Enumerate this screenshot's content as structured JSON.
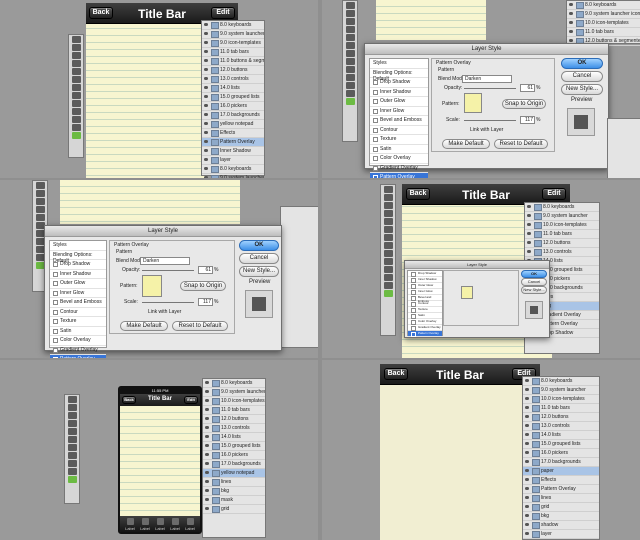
{
  "titlebar": {
    "back": "Back",
    "title": "Title Bar",
    "edit": "Edit"
  },
  "phone_status": {
    "time": "11:55 PM"
  },
  "phone_tabs": [
    "Label",
    "Label",
    "Label",
    "Label",
    "Label"
  ],
  "layers_a": [
    "8.0 keyboards",
    "9.0 system launcher icons",
    "9.0 icon-templates",
    "11.0 tab bars",
    "11.0 buttons & segmented controls",
    "12.0 buttons",
    "13.0 controls",
    "14.0 lists",
    "15.0 grouped lists",
    "16.0 pickers",
    "17.0 backgrounds",
    "yellow notepad",
    "Effects",
    "Pattern Overlay",
    "Inner Shadow",
    "layer",
    "8.0 keyboards",
    "9.0 system launcher icons",
    "10.0 icon-templates",
    "11.0 tab bars",
    "12.0 buttons & segmented c"
  ],
  "layers_b": [
    "8.0 keyboards",
    "9.0 system launcher icons",
    "10.0 icon-templates",
    "11.0 tab bars",
    "12.0 buttons & segmented c"
  ],
  "layers_d": [
    "8.0 keyboards",
    "9.0 system launcher",
    "10.0 icon-templates",
    "11.0 tab bars",
    "12.0 buttons",
    "13.0 controls",
    "14.0 lists",
    "15.0 grouped lists",
    "16.0 pickers",
    "17.0 backgrounds",
    "lines",
    "bkg",
    "Gradient Overlay",
    "Pattern Overlay",
    "Drop Shadow"
  ],
  "layers_e": [
    "8.0 keyboards",
    "9.0 system launcher icons",
    "10.0 icon-templates",
    "11.0 tab bars",
    "12.0 buttons",
    "13.0 controls",
    "14.0 lists",
    "15.0 grouped lists",
    "16.0 pickers",
    "17.0 backgrounds",
    "yellow notepad",
    "lines",
    "bkg",
    "mask",
    "grid"
  ],
  "layers_f": [
    "8.0 keyboards",
    "9.0 system launcher",
    "10.0 icon-templates",
    "11.0 tab bars",
    "12.0 buttons",
    "13.0 controls",
    "14.0 lists",
    "15.0 grouped lists",
    "16.0 pickers",
    "17.0 backgrounds",
    "paper",
    "Effects",
    "Pattern Overlay",
    "lines",
    "grid",
    "bkg",
    "shadow",
    "layer",
    "mask",
    "group"
  ],
  "layer_style": {
    "title": "Layer Style",
    "styles_header": "Styles",
    "blending": "Blending Options: Default",
    "items": [
      "Drop Shadow",
      "Inner Shadow",
      "Outer Glow",
      "Inner Glow",
      "Bevel and Emboss",
      "Contour",
      "Texture",
      "Satin",
      "Color Overlay",
      "Gradient Overlay",
      "Pattern Overlay"
    ],
    "group_title": "Pattern Overlay",
    "sub_title": "Pattern",
    "blend_label": "Blend Mode:",
    "blend_value": "Darken",
    "opacity_label": "Opacity:",
    "opacity_value": "61",
    "opacity_unit": "%",
    "pattern_label": "Pattern:",
    "snap": "Snap to Origin",
    "scale_label": "Scale:",
    "scale_value": "117",
    "scale_unit": "%",
    "link": "Link with Layer",
    "make_default": "Make Default",
    "reset_default": "Reset to Default",
    "ok": "OK",
    "cancel": "Cancel",
    "new_style": "New Style...",
    "preview": "Preview"
  },
  "colors": {
    "paper": "#f7f5d0",
    "accent": "#3875d7",
    "tool_green": "#6cbb43"
  }
}
